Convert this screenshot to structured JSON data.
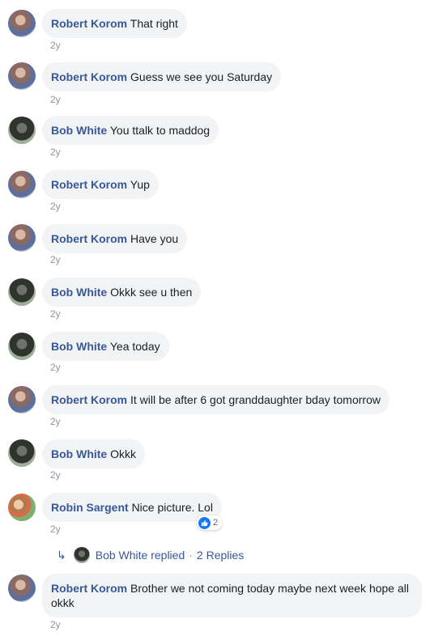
{
  "comments": [
    {
      "author": "Robert Korom",
      "text": "That right",
      "time": "2y"
    },
    {
      "author": "Robert Korom",
      "text": "Guess we see you Saturday",
      "time": "2y"
    },
    {
      "author": "Bob White",
      "text": "You ttalk to maddog",
      "time": "2y"
    },
    {
      "author": "Robert Korom",
      "text": "Yup",
      "time": "2y"
    },
    {
      "author": "Robert Korom",
      "text": "Have you",
      "time": "2y"
    },
    {
      "author": "Bob White",
      "text": "Okkk see u then",
      "time": "2y"
    },
    {
      "author": "Bob White",
      "text": "Yea today",
      "time": "2y"
    },
    {
      "author": "Robert Korom",
      "text": "It will be after 6 got granddaughter bday tomorrow",
      "time": "2y"
    },
    {
      "author": "Bob White",
      "text": "Okkk",
      "time": "2y"
    },
    {
      "author": "Robin Sargent",
      "text": "Nice picture. Lol",
      "time": "2y",
      "reaction": {
        "icon": "like-icon",
        "count": "2"
      }
    },
    {
      "author": "Robert Korom",
      "text": "Brother we not coming today maybe next week hope all okkk",
      "time": "2y"
    }
  ],
  "replies": {
    "replier": "Bob White replied",
    "separator": "·",
    "count_label": "2 Replies"
  },
  "colors": {
    "name": "#385898",
    "bubble": "#f2f3f5",
    "time": "#90949c",
    "like": "#1877f2"
  }
}
